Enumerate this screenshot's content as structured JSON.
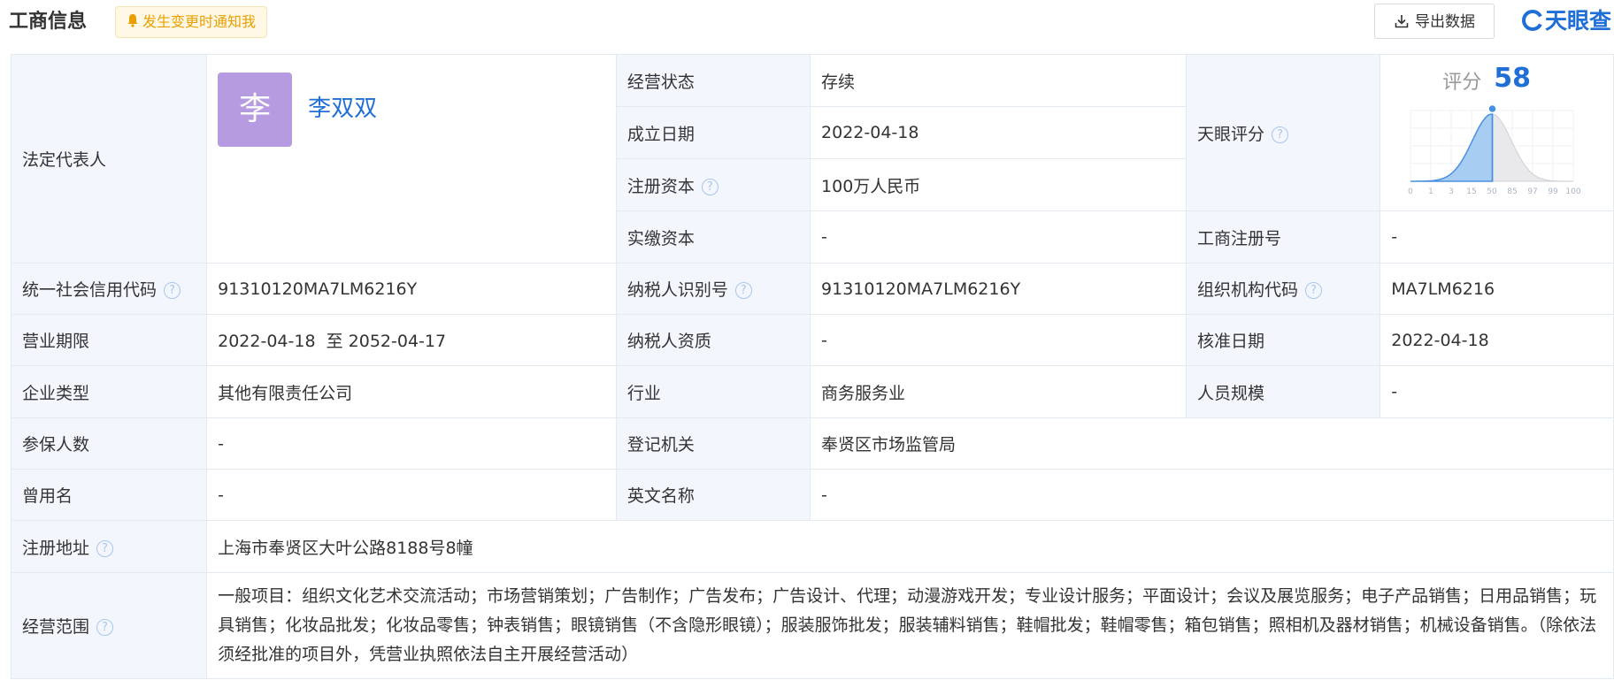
{
  "header": {
    "title": "工商信息",
    "notify_label": "发生变更时通知我",
    "export_label": "导出数据",
    "logo_text": "天眼查"
  },
  "legal": {
    "label": "法定代表人",
    "avatar_char": "李",
    "name": "李双双"
  },
  "status": {
    "label": "经营状态",
    "value": "存续"
  },
  "established": {
    "label": "成立日期",
    "value": "2022-04-18"
  },
  "registered_capital": {
    "label": "注册资本",
    "value": "100万人民币"
  },
  "paid_capital": {
    "label": "实缴资本",
    "value": "-"
  },
  "tianyan_score": {
    "label": "天眼评分",
    "score_label": "评分",
    "score": 58,
    "ticks": [
      "0",
      "1",
      "3",
      "15",
      "50",
      "85",
      "97",
      "99",
      "100"
    ]
  },
  "reg_number": {
    "label": "工商注册号",
    "value": "-"
  },
  "credit_code": {
    "label": "统一社会信用代码",
    "value": "91310120MA7LM6216Y"
  },
  "taxpayer_id": {
    "label": "纳税人识别号",
    "value": "91310120MA7LM6216Y"
  },
  "org_code": {
    "label": "组织机构代码",
    "value": "MA7LM6216"
  },
  "business_term": {
    "label": "营业期限",
    "value": "2022-04-18  至 2052-04-17"
  },
  "taxpayer_qual": {
    "label": "纳税人资质",
    "value": "-"
  },
  "approval_date": {
    "label": "核准日期",
    "value": "2022-04-18"
  },
  "company_type": {
    "label": "企业类型",
    "value": "其他有限责任公司"
  },
  "industry": {
    "label": "行业",
    "value": "商务服务业"
  },
  "staff_size": {
    "label": "人员规模",
    "value": "-"
  },
  "insured": {
    "label": "参保人数",
    "value": "-"
  },
  "reg_authority": {
    "label": "登记机关",
    "value": "奉贤区市场监管局"
  },
  "former_name": {
    "label": "曾用名",
    "value": "-"
  },
  "english_name": {
    "label": "英文名称",
    "value": "-"
  },
  "reg_address": {
    "label": "注册地址",
    "value": "上海市奉贤区大叶公路8188号8幢"
  },
  "business_scope": {
    "label": "经营范围",
    "value": "一般项目：组织文化艺术交流活动；市场营销策划；广告制作；广告发布；广告设计、代理；动漫游戏开发；专业设计服务；平面设计；会议及展览服务；电子产品销售；日用品销售；玩具销售；化妆品批发；化妆品零售；钟表销售；眼镜销售（不含隐形眼镜）；服装服饰批发；服装辅料销售；鞋帽批发；鞋帽零售；箱包销售；照相机及器材销售；机械设备销售。（除依法须经批准的项目外，凭营业执照依法自主开展经营活动）"
  },
  "colors": {
    "accent": "#1f6fd6",
    "label_bg": "#f3f7fd",
    "notify": "#e8a000",
    "avatar": "#b79be0"
  }
}
